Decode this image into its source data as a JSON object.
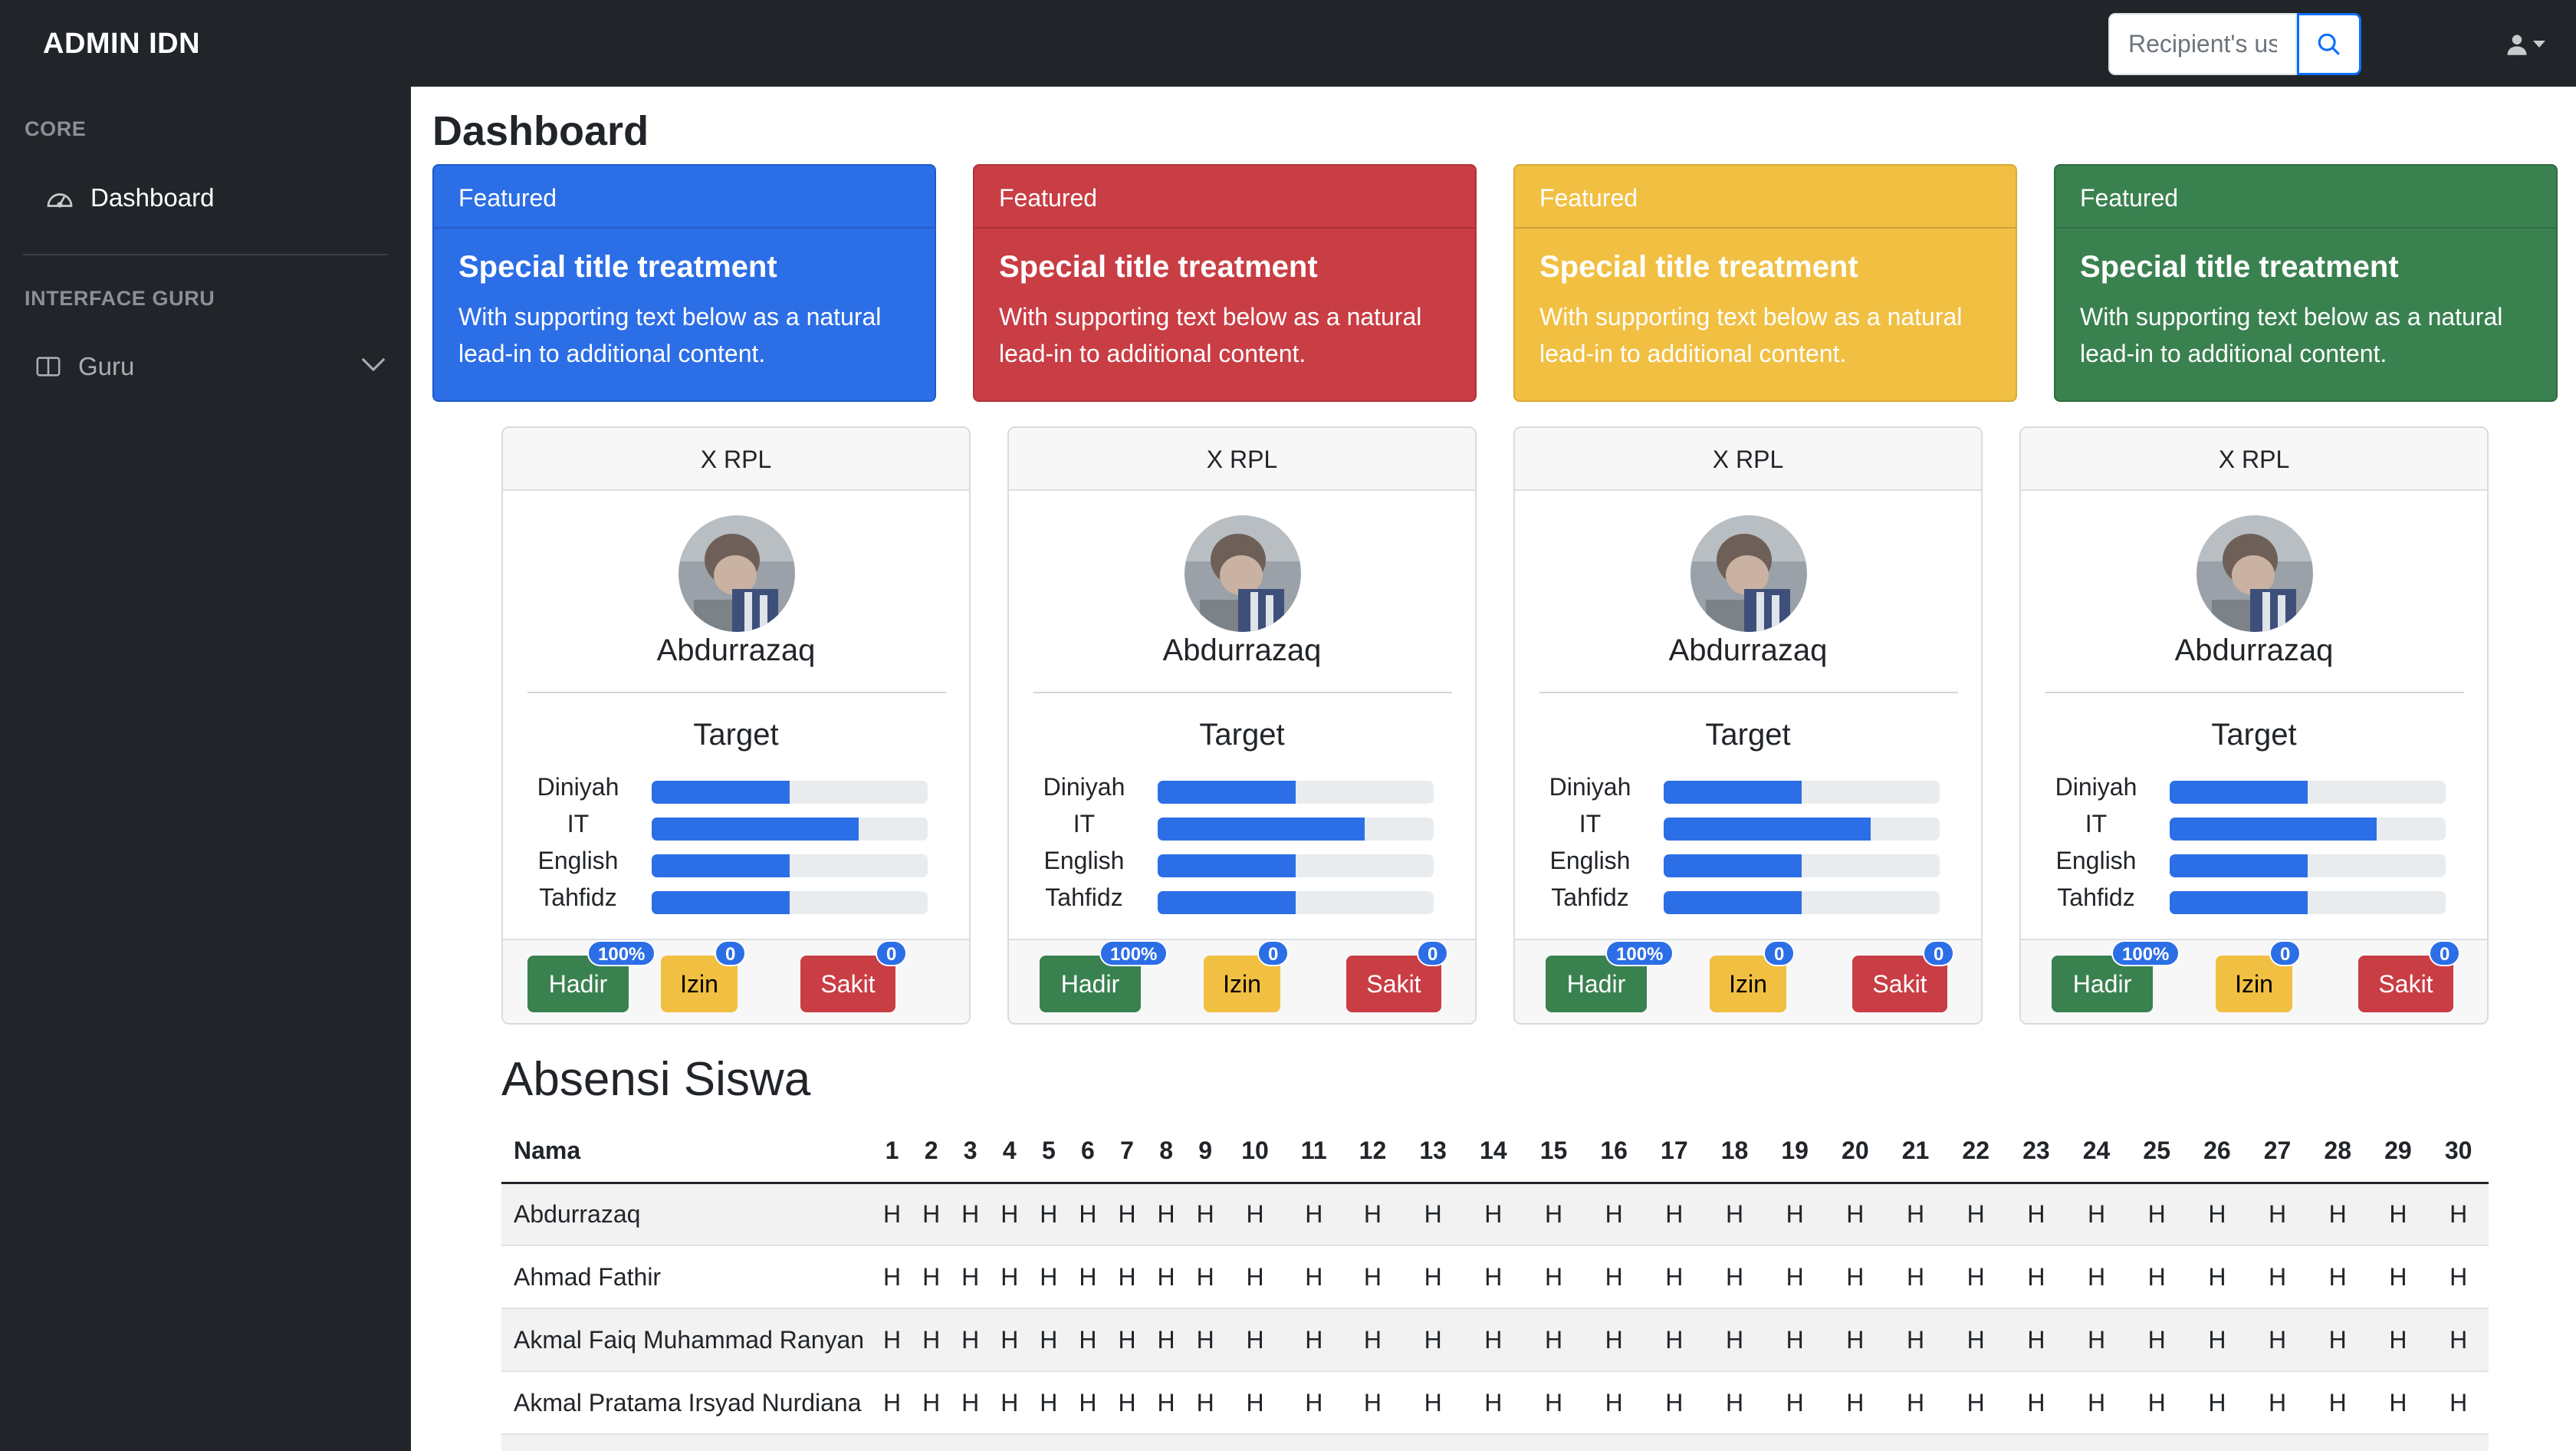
{
  "brand": "ADMIN IDN",
  "search": {
    "placeholder": "Recipient's username"
  },
  "sidebar": {
    "core_heading": "CORE",
    "dashboard_label": "Dashboard",
    "interface_heading": "INTERFACE GURU",
    "guru_label": "Guru"
  },
  "page_title": "Dashboard",
  "featured": [
    {
      "header": "Featured",
      "title": "Special title treatment",
      "text": "With supporting text below as a natural lead-in to additional content.",
      "color": "#2c6ee6"
    },
    {
      "header": "Featured",
      "title": "Special title treatment",
      "text": "With supporting text below as a natural lead-in to additional content.",
      "color": "#c93d44"
    },
    {
      "header": "Featured",
      "title": "Special title treatment",
      "text": "With supporting text below as a natural lead-in to additional content.",
      "color": "#f1bf42"
    },
    {
      "header": "Featured",
      "title": "Special title treatment",
      "text": "With supporting text below as a natural lead-in to additional content.",
      "color": "#3a8150"
    }
  ],
  "profiles": [
    {
      "class_name": "X RPL",
      "name": "Abdurrazaq",
      "target_title": "Target",
      "targets": [
        {
          "label": "Diniyah",
          "percent": 50
        },
        {
          "label": "IT",
          "percent": 75
        },
        {
          "label": "English",
          "percent": 50
        },
        {
          "label": "Tahfidz",
          "percent": 50
        }
      ],
      "status": {
        "hadir_label": "Hadir",
        "hadir_badge": "100%",
        "izin_label": "Izin",
        "izin_badge": "0",
        "sakit_label": "Sakit",
        "sakit_badge": "0"
      }
    },
    {
      "class_name": "X RPL",
      "name": "Abdurrazaq",
      "target_title": "Target",
      "targets": [
        {
          "label": "Diniyah",
          "percent": 50
        },
        {
          "label": "IT",
          "percent": 75
        },
        {
          "label": "English",
          "percent": 50
        },
        {
          "label": "Tahfidz",
          "percent": 50
        }
      ],
      "status": {
        "hadir_label": "Hadir",
        "hadir_badge": "100%",
        "izin_label": "Izin",
        "izin_badge": "0",
        "sakit_label": "Sakit",
        "sakit_badge": "0"
      }
    },
    {
      "class_name": "X RPL",
      "name": "Abdurrazaq",
      "target_title": "Target",
      "targets": [
        {
          "label": "Diniyah",
          "percent": 50
        },
        {
          "label": "IT",
          "percent": 75
        },
        {
          "label": "English",
          "percent": 50
        },
        {
          "label": "Tahfidz",
          "percent": 50
        }
      ],
      "status": {
        "hadir_label": "Hadir",
        "hadir_badge": "100%",
        "izin_label": "Izin",
        "izin_badge": "0",
        "sakit_label": "Sakit",
        "sakit_badge": "0"
      }
    },
    {
      "class_name": "X RPL",
      "name": "Abdurrazaq",
      "target_title": "Target",
      "targets": [
        {
          "label": "Diniyah",
          "percent": 50
        },
        {
          "label": "IT",
          "percent": 75
        },
        {
          "label": "English",
          "percent": 50
        },
        {
          "label": "Tahfidz",
          "percent": 50
        }
      ],
      "status": {
        "hadir_label": "Hadir",
        "hadir_badge": "100%",
        "izin_label": "Izin",
        "izin_badge": "0",
        "sakit_label": "Sakit",
        "sakit_badge": "0"
      }
    }
  ],
  "attendance": {
    "title": "Absensi Siswa",
    "name_header": "Nama",
    "days": [
      "1",
      "2",
      "3",
      "4",
      "5",
      "6",
      "7",
      "8",
      "9",
      "10",
      "11",
      "12",
      "13",
      "14",
      "15",
      "16",
      "17",
      "18",
      "19",
      "20",
      "21",
      "22",
      "23",
      "24",
      "25",
      "26",
      "27",
      "28",
      "29",
      "30"
    ],
    "rows": [
      {
        "name": "Abdurrazaq",
        "marks": [
          "H",
          "H",
          "H",
          "H",
          "H",
          "H",
          "H",
          "H",
          "H",
          "H",
          "H",
          "H",
          "H",
          "H",
          "H",
          "H",
          "H",
          "H",
          "H",
          "H",
          "H",
          "H",
          "H",
          "H",
          "H",
          "H",
          "H",
          "H",
          "H",
          "H"
        ]
      },
      {
        "name": "Ahmad Fathir",
        "marks": [
          "H",
          "H",
          "H",
          "H",
          "H",
          "H",
          "H",
          "H",
          "H",
          "H",
          "H",
          "H",
          "H",
          "H",
          "H",
          "H",
          "H",
          "H",
          "H",
          "H",
          "H",
          "H",
          "H",
          "H",
          "H",
          "H",
          "H",
          "H",
          "H",
          "H"
        ]
      },
      {
        "name": "Akmal Faiq Muhammad Ranyan",
        "marks": [
          "H",
          "H",
          "H",
          "H",
          "H",
          "H",
          "H",
          "H",
          "H",
          "H",
          "H",
          "H",
          "H",
          "H",
          "H",
          "H",
          "H",
          "H",
          "H",
          "H",
          "H",
          "H",
          "H",
          "H",
          "H",
          "H",
          "H",
          "H",
          "H",
          "H"
        ]
      },
      {
        "name": "Akmal Pratama Irsyad Nurdiana",
        "marks": [
          "H",
          "H",
          "H",
          "H",
          "H",
          "H",
          "H",
          "H",
          "H",
          "H",
          "H",
          "H",
          "H",
          "H",
          "H",
          "H",
          "H",
          "H",
          "H",
          "H",
          "H",
          "H",
          "H",
          "H",
          "H",
          "H",
          "H",
          "H",
          "H",
          "H"
        ]
      },
      {
        "name": "",
        "marks": [
          "",
          "",
          "",
          "",
          "",
          "",
          "",
          "",
          "",
          "",
          "",
          "",
          "",
          "",
          "",
          "",
          "",
          "",
          "",
          "",
          "",
          "",
          "",
          "",
          "",
          "",
          "",
          "",
          "",
          ""
        ]
      }
    ]
  }
}
